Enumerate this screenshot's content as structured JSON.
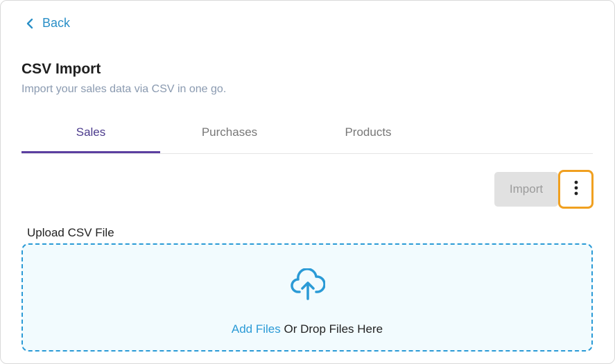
{
  "nav": {
    "back_label": "Back"
  },
  "header": {
    "title": "CSV Import",
    "subtitle": "Import your sales data via CSV in one go."
  },
  "tabs": [
    {
      "label": "Sales",
      "active": true
    },
    {
      "label": "Purchases",
      "active": false
    },
    {
      "label": "Products",
      "active": false
    }
  ],
  "toolbar": {
    "import_label": "Import",
    "more_icon": "more-vertical-icon"
  },
  "upload": {
    "label": "Upload CSV File",
    "add_files_label": "Add Files",
    "drop_text": " Or Drop Files Here",
    "icon": "cloud-upload-icon"
  },
  "colors": {
    "accent": "#2a9ad6",
    "tab_active": "#5b3fa0",
    "highlight": "#f0a020"
  }
}
